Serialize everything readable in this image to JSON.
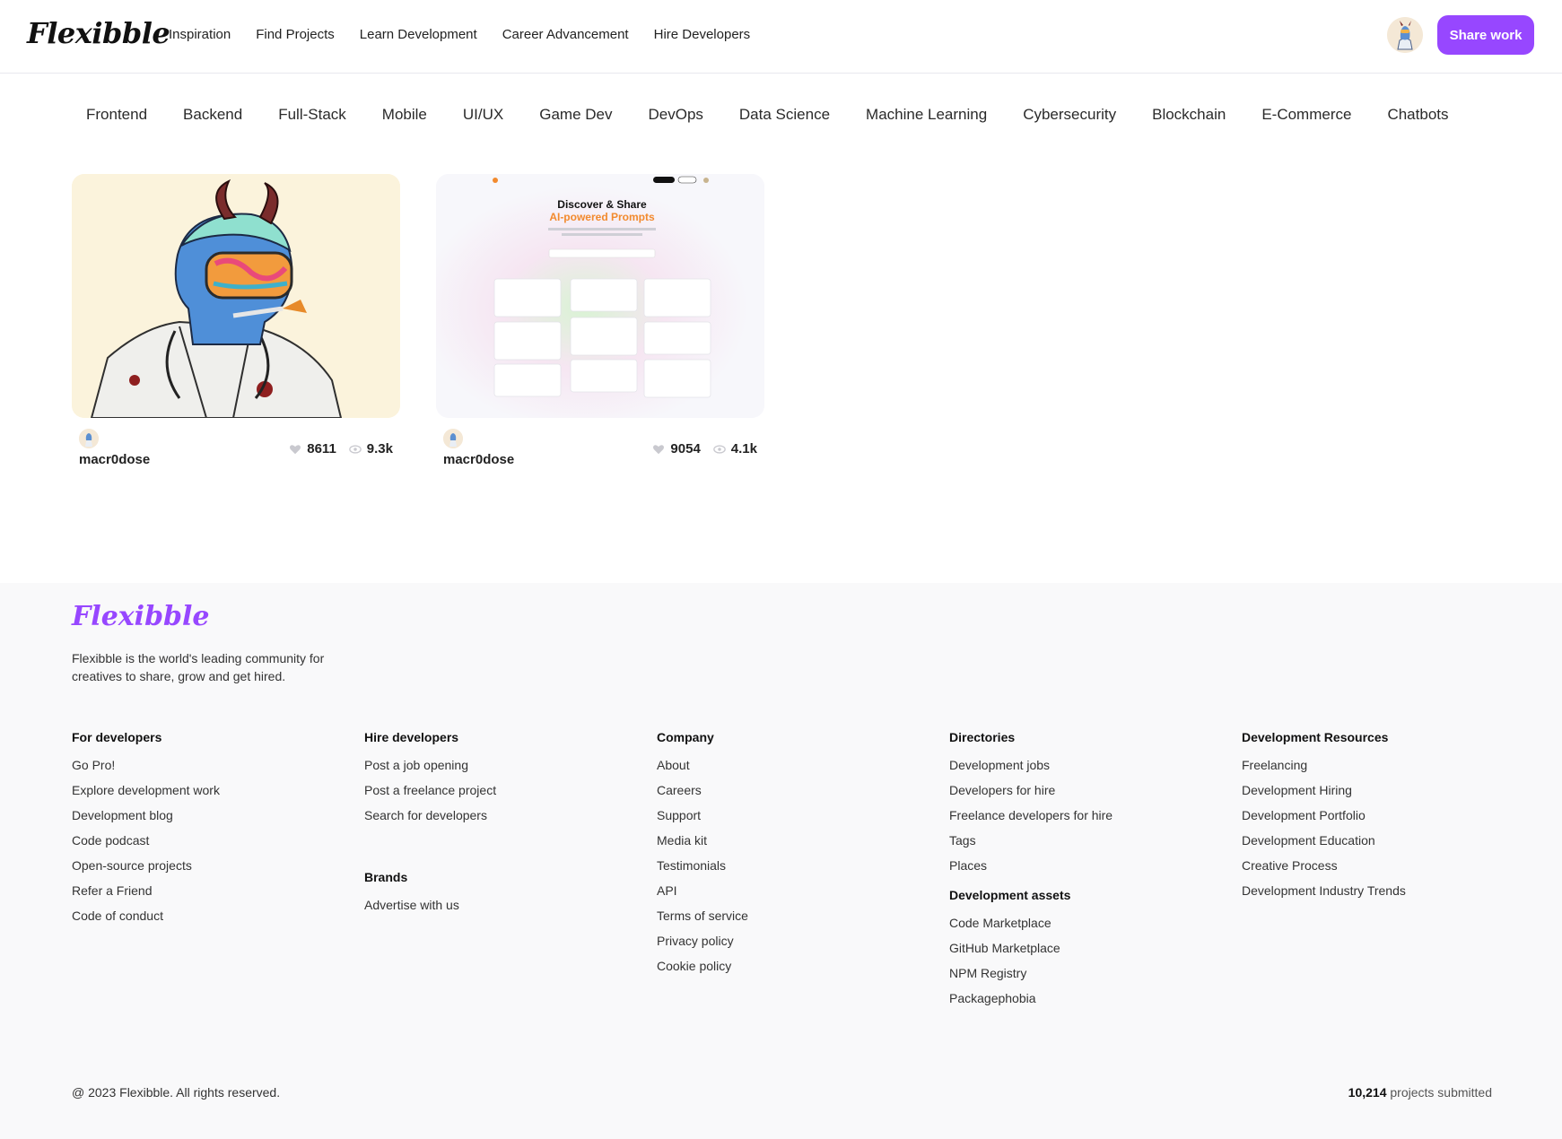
{
  "header": {
    "logo": "Flexibble",
    "nav": [
      "Inspiration",
      "Find Projects",
      "Learn Development",
      "Career Advancement",
      "Hire Developers"
    ],
    "share_label": "Share work",
    "accent": "#9747ff"
  },
  "categories": [
    "Frontend",
    "Backend",
    "Full-Stack",
    "Mobile",
    "UI/UX",
    "Game Dev",
    "DevOps",
    "Data Science",
    "Machine Learning",
    "Cybersecurity",
    "Blockchain",
    "E-Commerce",
    "Chatbots"
  ],
  "projects": [
    {
      "user": "macr0dose",
      "likes": "8611",
      "views": "9.3k"
    },
    {
      "user": "macr0dose",
      "likes": "9054",
      "views": "4.1k",
      "thumb_title_1": "Discover & Share",
      "thumb_title_2": "AI-powered Prompts"
    }
  ],
  "footer": {
    "logo": "Flexibble",
    "tagline": "Flexibble is the world's leading community for creatives to share, grow and get hired.",
    "columns": [
      {
        "title": "For developers",
        "links": [
          "Go Pro!",
          "Explore development work",
          "Development blog",
          "Code podcast",
          "Open-source projects",
          "Refer a Friend",
          "Code of conduct"
        ]
      },
      {
        "title": "Hire developers",
        "links": [
          "Post a job opening",
          "Post a freelance project",
          "Search for developers"
        ]
      },
      {
        "title": "Brands",
        "links": [
          "Advertise with us"
        ]
      },
      {
        "title": "Company",
        "links": [
          "About",
          "Careers",
          "Support",
          "Media kit",
          "Testimonials",
          "API",
          "Terms of service",
          "Privacy policy",
          "Cookie policy"
        ]
      },
      {
        "title": "Directories",
        "links": [
          "Development jobs",
          "Developers for hire",
          "Freelance developers for hire",
          "Tags",
          "Places"
        ]
      },
      {
        "title": "Development assets",
        "links": [
          "Code Marketplace",
          "GitHub Marketplace",
          "NPM Registry",
          "Packagephobia"
        ]
      },
      {
        "title": "Development Resources",
        "links": [
          "Freelancing",
          "Development Hiring",
          "Development Portfolio",
          "Development Education",
          "Creative Process",
          "Development Industry Trends"
        ]
      }
    ],
    "copyright": "@ 2023 Flexibble. All rights reserved.",
    "projects_count": "10,214",
    "projects_suffix": "projects submitted"
  }
}
